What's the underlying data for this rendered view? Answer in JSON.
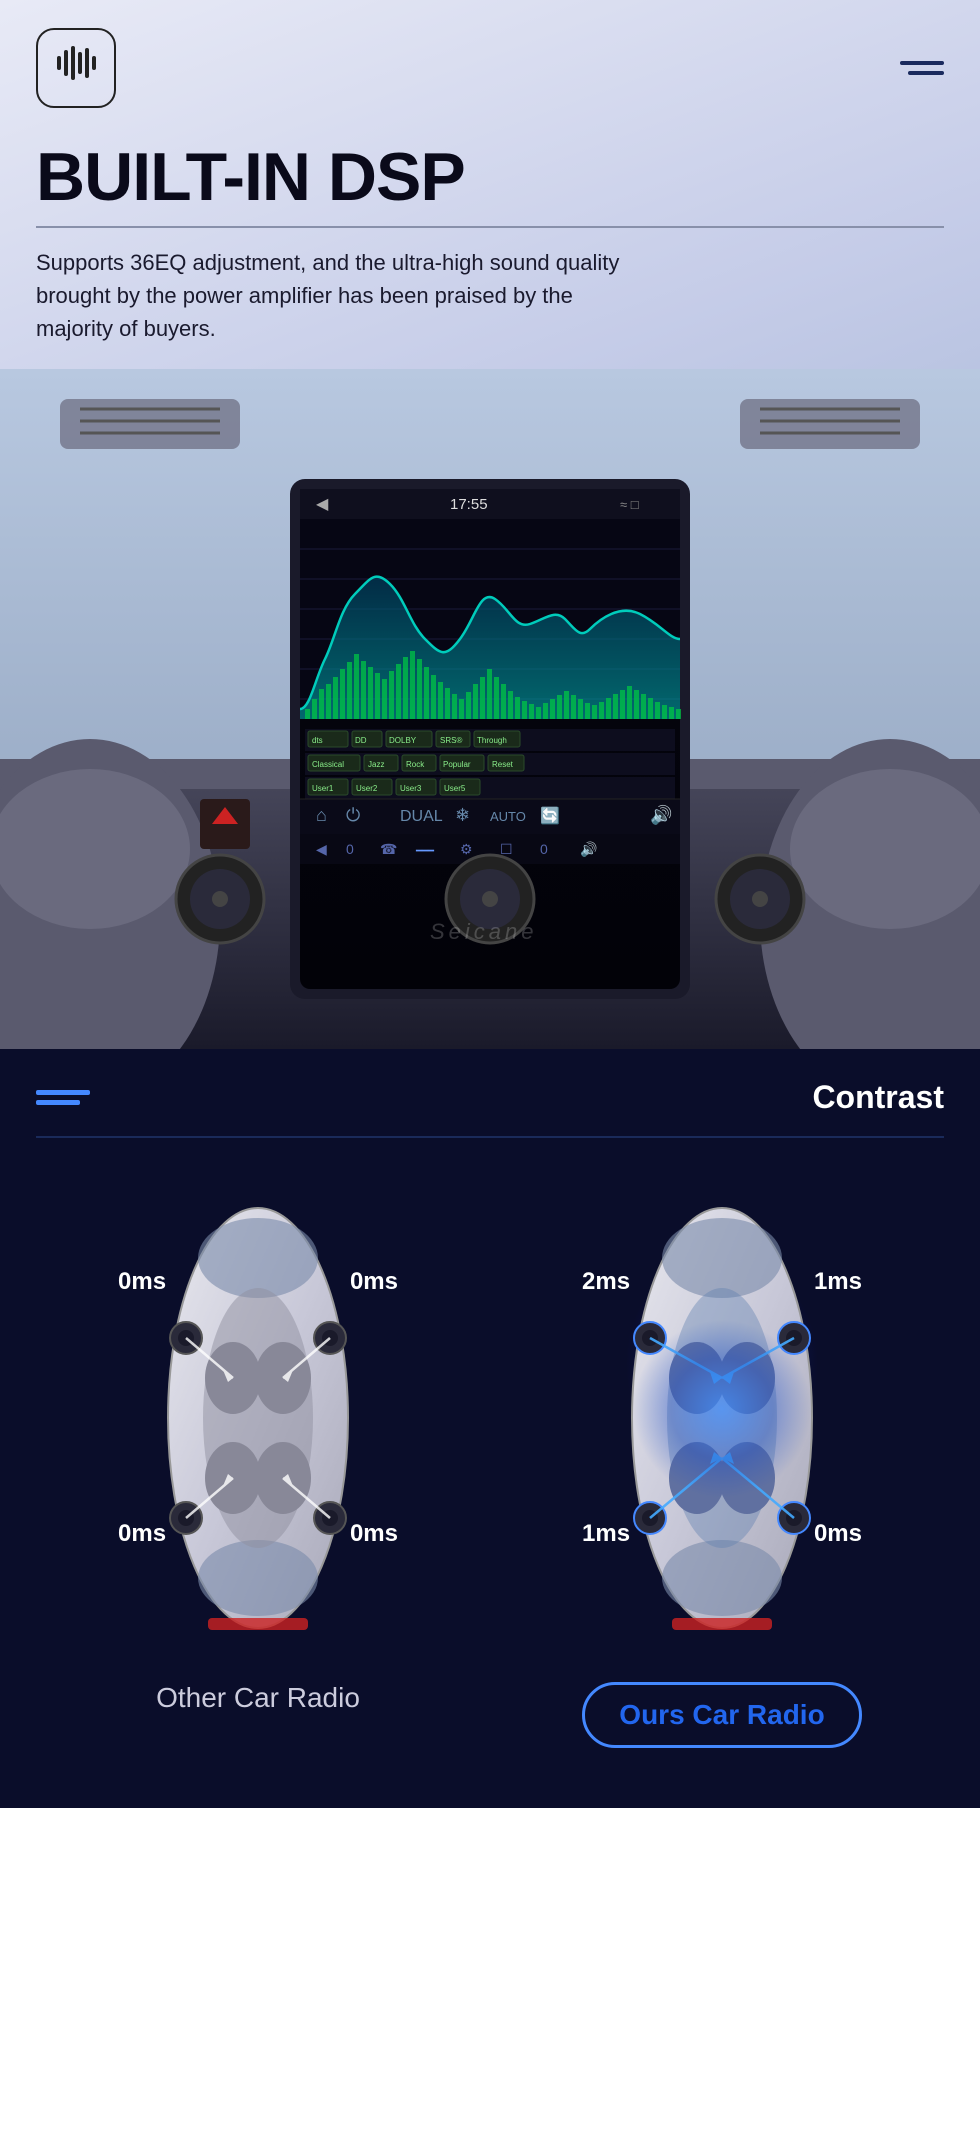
{
  "header": {
    "logo_alt": "audio logo",
    "hamburger_alt": "menu icon"
  },
  "hero": {
    "title": "BUILT-IN DSP",
    "description": "Supports 36EQ adjustment, and the ultra-high sound quality brought by the power amplifier has been praised by the majority of buyers."
  },
  "screen": {
    "time": "17:55",
    "back_label": "◀",
    "wifi_icons": "≈ □",
    "controls": {
      "rows": [
        [
          "dts",
          "DD",
          "DOLBY",
          "SRS®",
          "Through",
          "⊕⊖"
        ],
        [
          "Classical",
          "Jazz",
          "Rock",
          "Popular",
          "Reset",
          "⊕"
        ],
        [
          "User1",
          "User2",
          "User3",
          "User5",
          "⊕",
          "⊖"
        ]
      ],
      "bottom_icons": [
        "←",
        "0",
        "☎",
        "≈",
        "AUTO",
        "🔄",
        "🔊"
      ]
    }
  },
  "contrast": {
    "title": "Contrast",
    "divider": true
  },
  "comparison": {
    "left": {
      "labels": {
        "tl": "0ms",
        "tr": "0ms",
        "bl": "0ms",
        "br": "0ms"
      },
      "caption": "Other Car Radio"
    },
    "right": {
      "labels": {
        "tl": "2ms",
        "tr": "1ms",
        "bl": "1ms",
        "br": "0ms"
      },
      "caption": "Ours Car Radio"
    }
  },
  "eq_bars": [
    3,
    5,
    8,
    12,
    18,
    22,
    28,
    25,
    30,
    28,
    24,
    20,
    24,
    28,
    26,
    22,
    18,
    14,
    10,
    8,
    6,
    5,
    4,
    3,
    5,
    8,
    12,
    16,
    14,
    10,
    8,
    6,
    5,
    4,
    3
  ],
  "colors": {
    "accent_blue": "#4488ff",
    "dark_bg": "#0a0d2a",
    "eq_green": "#00cc66",
    "eq_teal": "#00bbaa"
  }
}
